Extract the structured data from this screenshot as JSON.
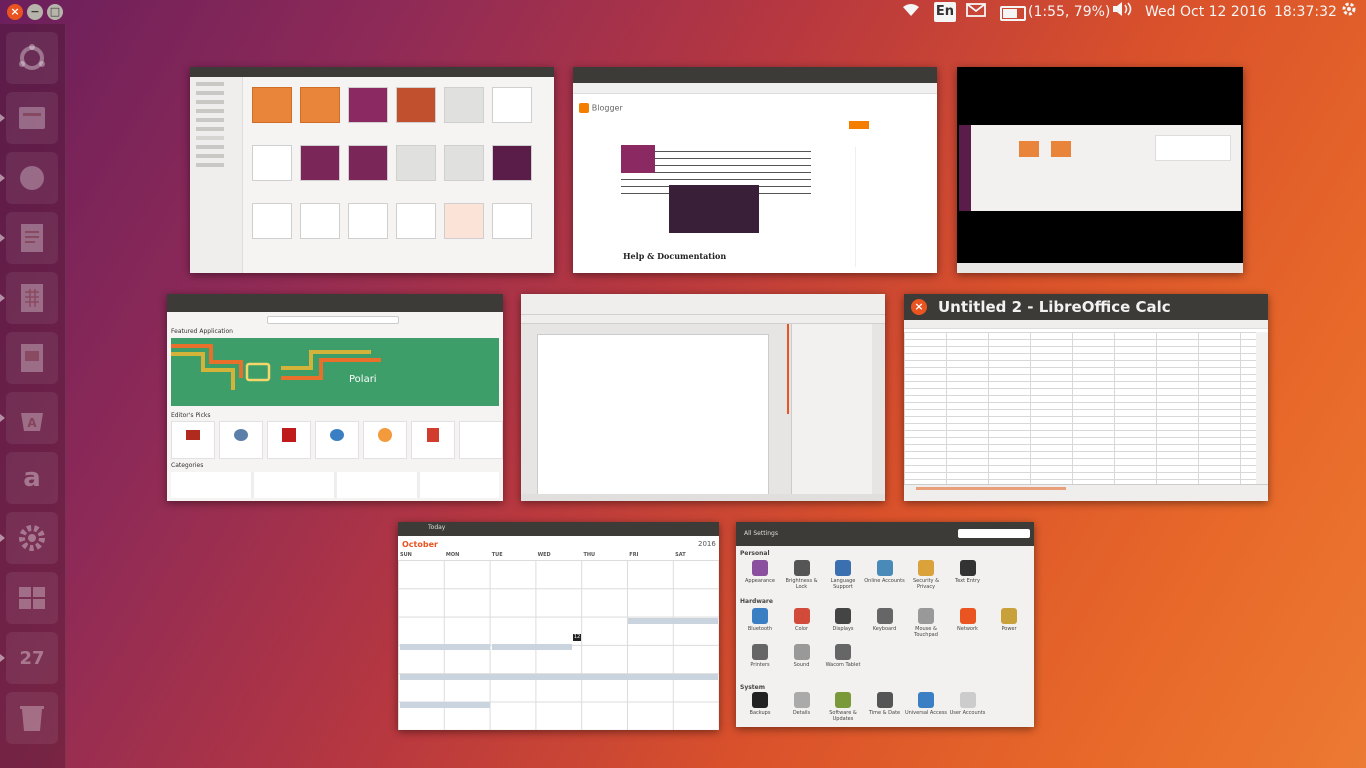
{
  "top_panel": {
    "close": "×",
    "minimize": "−",
    "maximize": "□",
    "language": "En",
    "battery_text": "(1:55, 79%)",
    "battery_level": 0.79,
    "date": "Wed Oct 12 2016",
    "time": "18:37:32"
  },
  "icons": {
    "wifi": "wifi-icon",
    "mail": "mail-icon",
    "volume": "volume-icon",
    "settings": "gear-icon"
  },
  "launcher": {
    "calendar_day": "27",
    "amazon": "a"
  },
  "windows": {
    "browser": {
      "blogger": "Blogger",
      "help_heading": "Help & Documentation"
    },
    "software": {
      "featured": "Featured Application",
      "polari": "Polari",
      "editors_picks": "Editor's Picks",
      "categories": "Categories"
    },
    "calc": {
      "title": "Untitled 2 - LibreOffice Calc"
    },
    "calendar": {
      "today": "Today",
      "month_label": "October",
      "year": "2016",
      "weekdays": [
        "SUN",
        "MON",
        "TUE",
        "WED",
        "THU",
        "FRI",
        "SAT"
      ],
      "highlight_day": "12"
    },
    "settings": {
      "title": "All Settings",
      "personal": "Personal",
      "hardware": "Hardware",
      "system": "System",
      "personal_items": [
        "Appearance",
        "Brightness & Lock",
        "Language Support",
        "Online Accounts",
        "Security & Privacy",
        "Text Entry"
      ],
      "hardware_items": [
        "Bluetooth",
        "Color",
        "Displays",
        "Keyboard",
        "Mouse & Touchpad",
        "Network",
        "Power",
        "Printers",
        "Sound",
        "Wacom Tablet"
      ],
      "system_items": [
        "Backups",
        "Details",
        "Software & Updates",
        "Time & Date",
        "Universal Access",
        "User Accounts"
      ]
    }
  },
  "colors": {
    "accent": "#e95420",
    "titlebar": "#3c3b37",
    "polari_green": "#3e9e6a"
  }
}
